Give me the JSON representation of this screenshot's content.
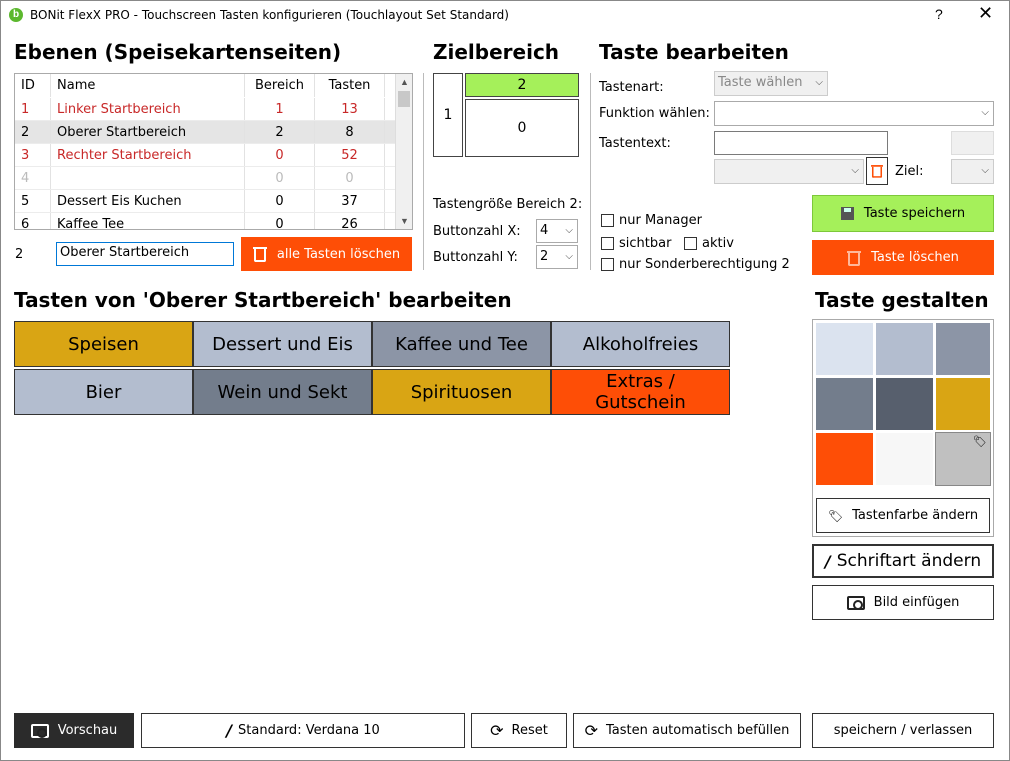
{
  "window": {
    "title": "BONit FlexX PRO - Touchscreen Tasten konfigurieren (Touchlayout Set Standard)",
    "help": "?",
    "close": "✕"
  },
  "levels": {
    "heading": "Ebenen (Speisekartenseiten)",
    "columns": {
      "id": "ID",
      "name": "Name",
      "bereich": "Bereich",
      "tasten": "Tasten"
    },
    "rows": [
      {
        "id": "1",
        "name": "Linker Startbereich",
        "bereich": "1",
        "tasten": "13",
        "state": "red"
      },
      {
        "id": "2",
        "name": "Oberer Startbereich",
        "bereich": "2",
        "tasten": "8",
        "state": "selected"
      },
      {
        "id": "3",
        "name": "Rechter Startbereich",
        "bereich": "0",
        "tasten": "52",
        "state": "red"
      },
      {
        "id": "4",
        "name": "",
        "bereich": "0",
        "tasten": "0",
        "state": "grey"
      },
      {
        "id": "5",
        "name": "Dessert Eis Kuchen",
        "bereich": "0",
        "tasten": "37",
        "state": "normal"
      },
      {
        "id": "6",
        "name": "Kaffee Tee",
        "bereich": "0",
        "tasten": "26",
        "state": "normal"
      }
    ],
    "selected_id": "2",
    "selected_name": "Oberer Startbereich",
    "delete_all": "alle Tasten löschen"
  },
  "target": {
    "heading": "Zielbereich",
    "left_value": "1",
    "top_value": "2",
    "main_value": "0",
    "size_label": "Tastengröße Bereich 2:",
    "x_label": "Buttonzahl X:",
    "x_value": "4",
    "y_label": "Buttonzahl Y:",
    "y_value": "2"
  },
  "edit": {
    "heading": "Taste bearbeiten",
    "type_label": "Tastenart:",
    "type_value": "Taste wählen",
    "function_label": "Funktion wählen:",
    "function_value": "",
    "text_label": "Tastentext:",
    "text_value": "",
    "ziel_label": "Ziel:",
    "cb_manager": "nur Manager",
    "cb_visible": "sichtbar",
    "cb_active": "aktiv",
    "cb_special": "nur Sonderberechtigung 2",
    "save": "Taste speichern",
    "delete": "Taste löschen"
  },
  "keys": {
    "heading": "Tasten von 'Oberer Startbereich' bearbeiten",
    "items": [
      {
        "label": "Speisen",
        "color": "#d9a514"
      },
      {
        "label": "Dessert und Eis",
        "color": "#b3bdcf"
      },
      {
        "label": "Kaffee und Tee",
        "color": "#8c95a6"
      },
      {
        "label": "Alkoholfreies",
        "color": "#b3bdcf"
      },
      {
        "label": "Bier",
        "color": "#b3bdcf"
      },
      {
        "label": "Wein und Sekt",
        "color": "#737d8c"
      },
      {
        "label": "Spirituosen",
        "color": "#d9a514"
      },
      {
        "label": "Extras / Gutschein",
        "color": "#fe4e06"
      }
    ]
  },
  "design": {
    "heading": "Taste gestalten",
    "swatches": [
      "#dbe3ef",
      "#b3bdcf",
      "#8c95a6",
      "#737d8c",
      "#575f6d",
      "#d9a514",
      "#fe4e06",
      "#f7f7f7",
      "#c0c0c0"
    ],
    "color_button": "Tastenfarbe ändern",
    "font_button": "Schriftart ändern",
    "image_button": "Bild einfügen"
  },
  "footer": {
    "preview": "Vorschau",
    "font_standard": "Standard: Verdana 10",
    "reset": "Reset",
    "autofill": "Tasten automatisch befüllen",
    "save_exit": "speichern / verlassen"
  },
  "colors": {
    "green": "#a5f05a",
    "orange": "#fe4e06",
    "dark": "#2b2b2b"
  }
}
